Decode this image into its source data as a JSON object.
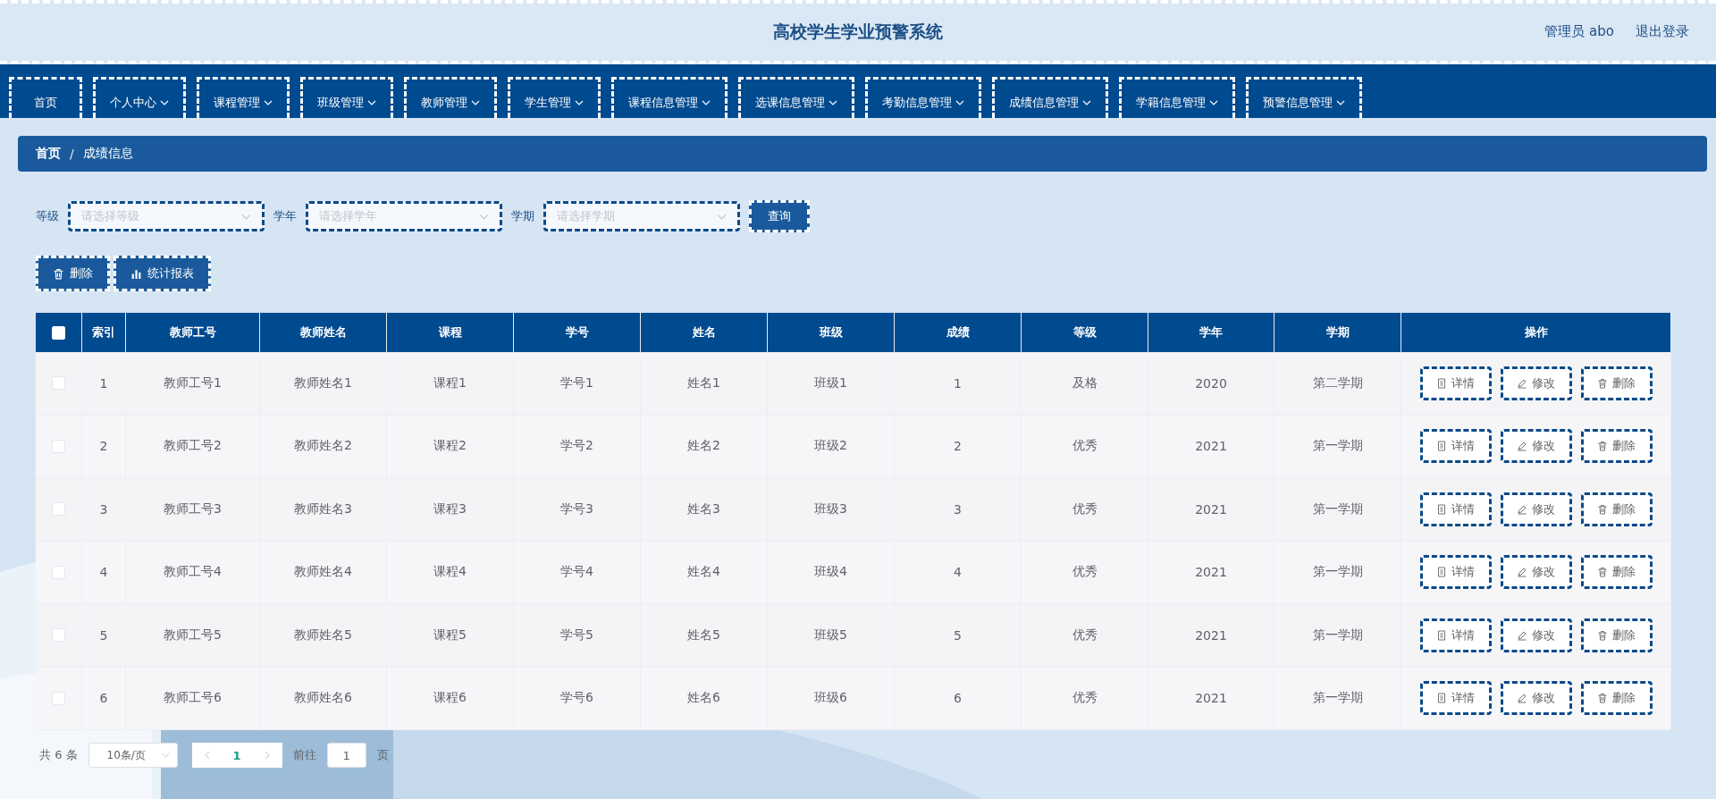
{
  "header": {
    "title": "高校学生学业预警系统",
    "user": "管理员 abo",
    "logout": "退出登录"
  },
  "nav": [
    {
      "label": "首页",
      "dropdown": false
    },
    {
      "label": "个人中心",
      "dropdown": true
    },
    {
      "label": "课程管理",
      "dropdown": true
    },
    {
      "label": "班级管理",
      "dropdown": true
    },
    {
      "label": "教师管理",
      "dropdown": true
    },
    {
      "label": "学生管理",
      "dropdown": true
    },
    {
      "label": "课程信息管理",
      "dropdown": true
    },
    {
      "label": "选课信息管理",
      "dropdown": true
    },
    {
      "label": "考勤信息管理",
      "dropdown": true
    },
    {
      "label": "成绩信息管理",
      "dropdown": true
    },
    {
      "label": "学籍信息管理",
      "dropdown": true
    },
    {
      "label": "预警信息管理",
      "dropdown": true
    }
  ],
  "breadcrumb": {
    "items": [
      "首页",
      "成绩信息"
    ],
    "separator": "/"
  },
  "filters": [
    {
      "label": "等级",
      "placeholder": "请选择等级"
    },
    {
      "label": "学年",
      "placeholder": "请选择学年"
    },
    {
      "label": "学期",
      "placeholder": "请选择学期"
    }
  ],
  "search_button": "查询",
  "actions": [
    {
      "label": "删除",
      "kind": "delete"
    },
    {
      "label": "统计报表",
      "kind": "chart"
    }
  ],
  "table": {
    "all_checked": false,
    "columns": [
      "索引",
      "教师工号",
      "教师姓名",
      "课程",
      "学号",
      "姓名",
      "班级",
      "成绩",
      "等级",
      "学年",
      "学期",
      "操作"
    ],
    "rows": [
      {
        "checked": false,
        "cells": [
          "1",
          "教师工号1",
          "教师姓名1",
          "课程1",
          "学号1",
          "姓名1",
          "班级1",
          "1",
          "及格",
          "2020",
          "第二学期"
        ],
        "actions": [
          {
            "label": "详情",
            "kind": "detail"
          },
          {
            "label": "修改",
            "kind": "edit"
          },
          {
            "label": "删除",
            "kind": "delete"
          }
        ]
      },
      {
        "checked": false,
        "cells": [
          "2",
          "教师工号2",
          "教师姓名2",
          "课程2",
          "学号2",
          "姓名2",
          "班级2",
          "2",
          "优秀",
          "2021",
          "第一学期"
        ],
        "actions": [
          {
            "label": "详情",
            "kind": "detail"
          },
          {
            "label": "修改",
            "kind": "edit"
          },
          {
            "label": "删除",
            "kind": "delete"
          }
        ]
      },
      {
        "checked": false,
        "cells": [
          "3",
          "教师工号3",
          "教师姓名3",
          "课程3",
          "学号3",
          "姓名3",
          "班级3",
          "3",
          "优秀",
          "2021",
          "第一学期"
        ],
        "actions": [
          {
            "label": "详情",
            "kind": "detail"
          },
          {
            "label": "修改",
            "kind": "edit"
          },
          {
            "label": "删除",
            "kind": "delete"
          }
        ]
      },
      {
        "checked": false,
        "cells": [
          "4",
          "教师工号4",
          "教师姓名4",
          "课程4",
          "学号4",
          "姓名4",
          "班级4",
          "4",
          "优秀",
          "2021",
          "第一学期"
        ],
        "actions": [
          {
            "label": "详情",
            "kind": "detail"
          },
          {
            "label": "修改",
            "kind": "edit"
          },
          {
            "label": "删除",
            "kind": "delete"
          }
        ]
      },
      {
        "checked": false,
        "cells": [
          "5",
          "教师工号5",
          "教师姓名5",
          "课程5",
          "学号5",
          "姓名5",
          "班级5",
          "5",
          "优秀",
          "2021",
          "第一学期"
        ],
        "actions": [
          {
            "label": "详情",
            "kind": "detail"
          },
          {
            "label": "修改",
            "kind": "edit"
          },
          {
            "label": "删除",
            "kind": "delete"
          }
        ]
      },
      {
        "checked": false,
        "cells": [
          "6",
          "教师工号6",
          "教师姓名6",
          "课程6",
          "学号6",
          "姓名6",
          "班级6",
          "6",
          "优秀",
          "2021",
          "第一学期"
        ],
        "actions": [
          {
            "label": "详情",
            "kind": "detail"
          },
          {
            "label": "修改",
            "kind": "edit"
          },
          {
            "label": "删除",
            "kind": "delete"
          }
        ]
      }
    ]
  },
  "pagination": {
    "total": "共 6 条",
    "page_size": "10条/页",
    "pages": [
      {
        "label": "1",
        "selected": true
      }
    ],
    "goto_label": "前往",
    "goto_value": "1",
    "goto_suffix": "页"
  }
}
